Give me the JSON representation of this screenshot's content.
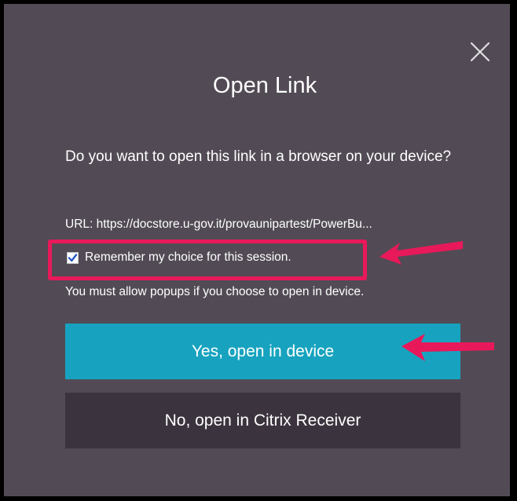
{
  "dialog": {
    "title": "Open Link",
    "question": "Do you want to open this link in a browser on your device?",
    "url_text": "URL: https://docstore.u-gov.it/provaunipartest/PowerBu...",
    "remember_label": "Remember my choice for this session.",
    "remember_checked": true,
    "popup_note": "You must allow popups if you choose to open in device.",
    "yes_button_label": "Yes, open in device",
    "no_button_label": "No, open in Citrix Receiver",
    "close_icon": "close-icon"
  },
  "colors": {
    "dialog_background": "#524b55",
    "yes_button": "#17a3bf",
    "no_button": "#3b343e",
    "annotation": "#e8195a"
  }
}
